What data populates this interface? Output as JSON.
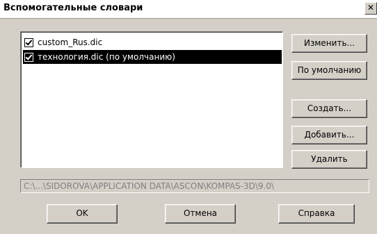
{
  "window": {
    "title": "Вспомогательные словари",
    "close_glyph": "✕"
  },
  "dictionaries": [
    {
      "name": "custom_Rus.dic",
      "checked": true,
      "selected": false
    },
    {
      "name": "технология.dic (по умолчанию)",
      "checked": true,
      "selected": true
    }
  ],
  "side_buttons": {
    "edit": "Изменить...",
    "default": "По умолчанию",
    "create": "Создать...",
    "add": "Добавить...",
    "delete": "Удалить"
  },
  "path": "C:\\...\\SIDOROVA\\APPLICATION DATA\\ASCON\\KOMPAS-3D\\9.0\\",
  "bottom_buttons": {
    "ok": "OK",
    "cancel": "Отмена",
    "help": "Справка"
  }
}
